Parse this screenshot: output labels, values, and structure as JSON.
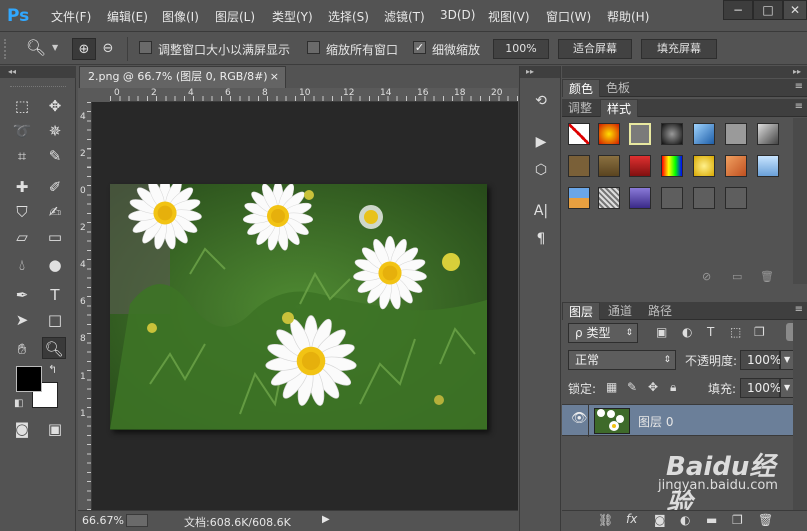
{
  "app": {
    "logo": "Ps"
  },
  "menu": [
    "文件(F)",
    "编辑(E)",
    "图像(I)",
    "图层(L)",
    "类型(Y)",
    "选择(S)",
    "滤镜(T)",
    "3D(D)",
    "视图(V)",
    "窗口(W)",
    "帮助(H)"
  ],
  "window_controls": {
    "minimize": "−",
    "maximize": "□",
    "close": "✕"
  },
  "options": {
    "fit_window_label": "调整窗口大小以满屏显示",
    "fit_window_checked": false,
    "zoom_all_label": "缩放所有窗口",
    "zoom_all_checked": false,
    "scrubby_label": "细微缩放",
    "scrubby_checked": true,
    "btn_100": "100%",
    "btn_fit": "适合屏幕",
    "btn_fill": "填充屏幕"
  },
  "document": {
    "tab_title": "2.png @ 66.7% (图层 0, RGB/8#)",
    "close": "×",
    "ruler_h": [
      "0",
      "2",
      "4",
      "6",
      "8",
      "10",
      "12",
      "14",
      "16",
      "18",
      "20"
    ],
    "ruler_v": [
      "4",
      "2",
      "0",
      "2",
      "4",
      "6",
      "8",
      "1",
      "1"
    ]
  },
  "status": {
    "zoom": "66.67%",
    "doc_size": "文档:608.6K/608.6K"
  },
  "panels": {
    "color_tabs": [
      "颜色",
      "色板"
    ],
    "style_tabs": [
      "调整",
      "样式"
    ],
    "layer_tabs": [
      "图层",
      "通道",
      "路径"
    ],
    "kind_filter": "类型",
    "blend_mode": "正常",
    "opacity_label": "不透明度:",
    "opacity_value": "100%",
    "lock_label": "锁定:",
    "fill_label": "填充:",
    "fill_value": "100%",
    "layer_name": "图层 0"
  },
  "watermark": {
    "brand": "Baidu经验",
    "url": "jingyan.baidu.com"
  },
  "colors": {
    "accent": "#31a8ff",
    "layer_selected": "#6b7f99",
    "canvas_bg": "#282828"
  }
}
